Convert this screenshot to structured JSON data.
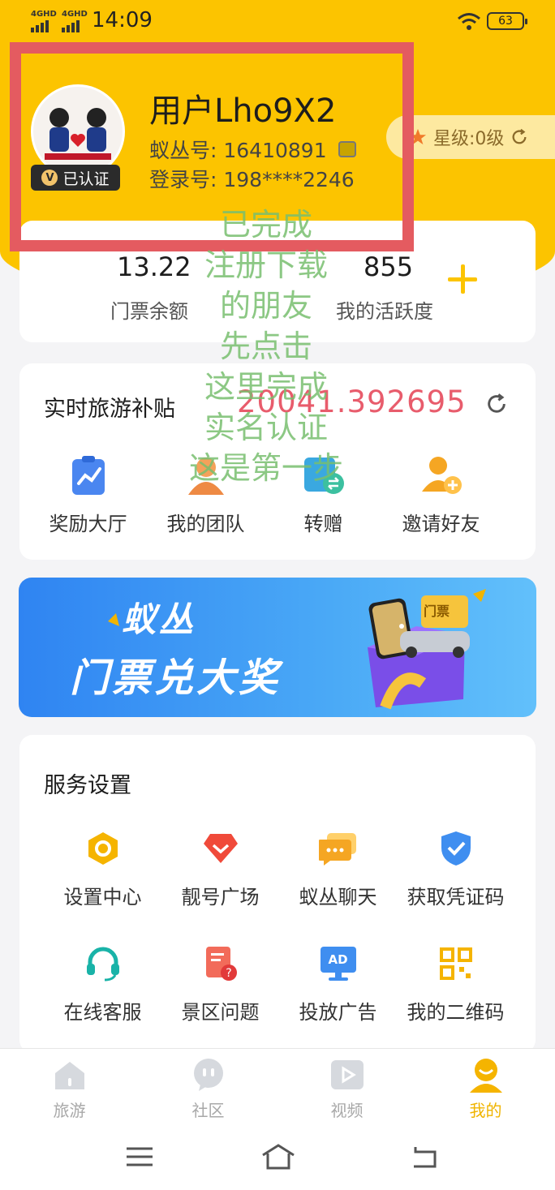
{
  "status_bar": {
    "net1": "4GHD",
    "net2": "4GHD",
    "time": "14:09",
    "battery": "63"
  },
  "profile": {
    "username": "用户Lho9X2",
    "uid_label": "蚁丛号: 16410891",
    "login_label": "登录号: 198****2246",
    "verified_badge": "已认证",
    "verified_icon": "V",
    "star_level": "星级:0级"
  },
  "stats": {
    "balance_value": "13.22",
    "balance_label": "门票余额",
    "activity_value": "855",
    "activity_label": "我的活跃度"
  },
  "subsidy": {
    "title": "实时旅游补贴",
    "value": "20041.392695",
    "items": [
      {
        "label": "奖励大厅",
        "icon": "chart-icon"
      },
      {
        "label": "我的团队",
        "icon": "team-icon"
      },
      {
        "label": "转赠",
        "icon": "transfer-icon"
      },
      {
        "label": "邀请好友",
        "icon": "invite-icon"
      }
    ]
  },
  "banner": {
    "line1": "蚁丛",
    "line2": "门票兑大奖",
    "ticket_tag": "门票"
  },
  "services": {
    "title": "服务设置",
    "items": [
      {
        "label": "设置中心",
        "icon": "settings-icon"
      },
      {
        "label": "靓号广场",
        "icon": "diamond-icon"
      },
      {
        "label": "蚁丛聊天",
        "icon": "chat-icon"
      },
      {
        "label": "获取凭证码",
        "icon": "shield-icon"
      },
      {
        "label": "在线客服",
        "icon": "headset-icon"
      },
      {
        "label": "景区问题",
        "icon": "question-doc-icon"
      },
      {
        "label": "投放广告",
        "icon": "ad-icon"
      },
      {
        "label": "我的二维码",
        "icon": "qrcode-icon"
      }
    ],
    "ad_text": "AD"
  },
  "overlay_text": [
    "已完成",
    "注册下载",
    "的朋友",
    "先点击",
    "这里完成",
    "实名认证",
    "这是第一步"
  ],
  "tabbar": [
    {
      "label": "旅游",
      "icon": "home-icon"
    },
    {
      "label": "社区",
      "icon": "community-icon"
    },
    {
      "label": "视频",
      "icon": "video-icon"
    },
    {
      "label": "我的",
      "icon": "profile-icon"
    }
  ],
  "colors": {
    "brand_yellow": "#fcc400",
    "highlight_red": "#e45b60",
    "subsidy_red": "#e85c6c",
    "banner_blue": "#2f84f2",
    "overlay_green": "#78be6e"
  }
}
